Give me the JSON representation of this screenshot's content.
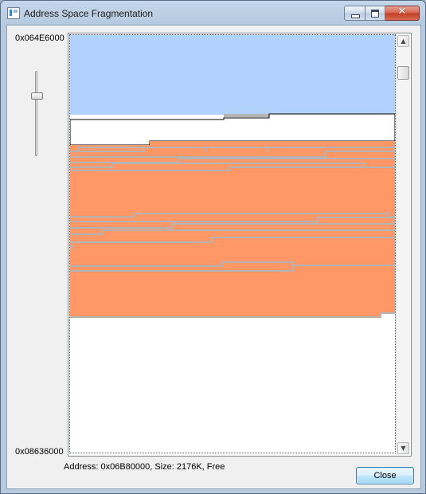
{
  "window": {
    "title": "Address Space Fragmentation",
    "icon": "app-window-icon",
    "controls": {
      "minimize_icon": "minimize-icon",
      "maximize_icon": "maximize-icon",
      "close_glyph": "✕"
    }
  },
  "range": {
    "start_address": "0x064E6000",
    "end_address": "0x08636000"
  },
  "zoom_slider": {
    "level_fraction": 0.3
  },
  "map": {
    "colors": {
      "reserved_region": "#b0d2fc",
      "committed_region": "#ff9766",
      "free": "#ffffff",
      "allocation_lines": "#b4b4b4",
      "outline": "#000000"
    }
  },
  "scrollbar": {
    "up_arrow": "▲",
    "down_arrow": "▼",
    "position_fraction": 0.08
  },
  "status": {
    "text": "Address: 0x06B80000, Size: 2176K, Free"
  },
  "buttons": {
    "close_label": "Close"
  }
}
